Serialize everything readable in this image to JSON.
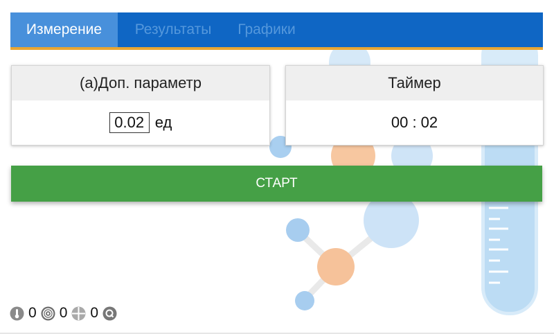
{
  "tabs": [
    {
      "label": "Измерение",
      "active": true
    },
    {
      "label": "Результаты",
      "active": false
    },
    {
      "label": "Графики",
      "active": false
    }
  ],
  "param_card": {
    "title": "(а)Доп. параметр",
    "value": "0.02",
    "unit": "ед"
  },
  "timer_card": {
    "title": "Таймер",
    "value": "00 : 02"
  },
  "start_button": {
    "label": "СТАРТ"
  },
  "status": {
    "items": [
      {
        "icon": "thermometer-icon",
        "value": "0"
      },
      {
        "icon": "spiral-icon",
        "value": "0"
      },
      {
        "icon": "crosshair-icon",
        "value": "0"
      },
      {
        "icon": "q-icon",
        "value": ""
      }
    ]
  },
  "colors": {
    "tab_bar": "#0f66c4",
    "tab_active": "#4890db",
    "tab_accent": "#e8a633",
    "start_button": "#45a046"
  }
}
